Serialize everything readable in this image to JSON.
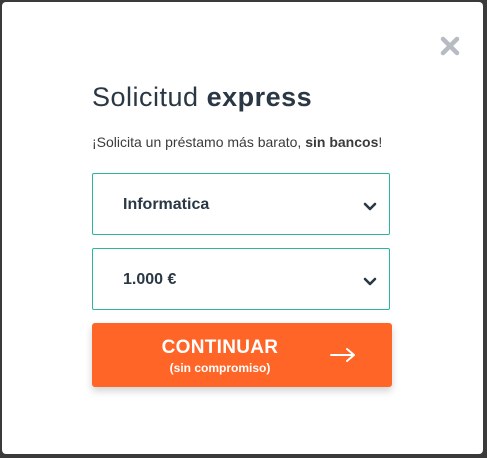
{
  "modal": {
    "title_regular": "Solicitud",
    "title_bold": "express",
    "subtitle_prefix": "¡Solicita un préstamo más barato, ",
    "subtitle_bold": "sin bancos",
    "subtitle_suffix": "!",
    "close_icon": "close-x-icon",
    "category_select": {
      "selected": "Informatica"
    },
    "amount_select": {
      "selected": "1.000 €"
    },
    "cta": {
      "label": "CONTINUAR",
      "sublabel": "(sin compromiso)",
      "icon": "arrow-right-icon"
    }
  },
  "colors": {
    "accent": "#ff6527",
    "select_border": "#2bb5a0",
    "text_dark": "#2a3744",
    "close_icon": "#b7bcc2",
    "overlay": "#3a3a3a"
  }
}
